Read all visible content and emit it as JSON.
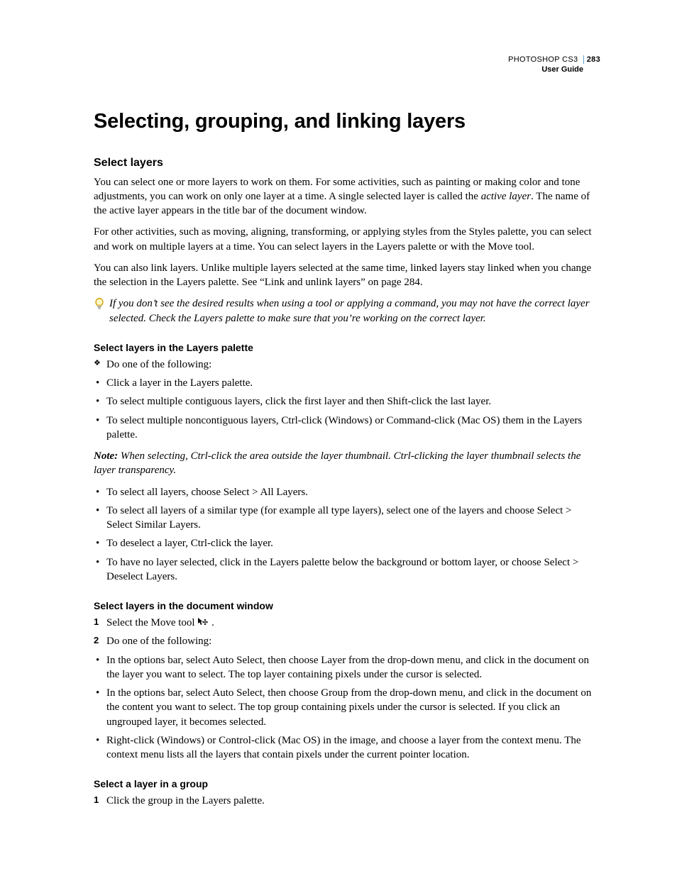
{
  "header": {
    "product": "PHOTOSHOP CS3",
    "page_number": "283",
    "doc_title": "User Guide"
  },
  "h1": "Selecting, grouping, and linking layers",
  "h2_select_layers": "Select layers",
  "para1_a": "You can select one or more layers to work on them. For some activities, such as painting or making color and tone adjustments, you can work on only one layer at a time. A single selected layer is called the ",
  "para1_term": "active layer",
  "para1_b": ". The name of the active layer appears in the title bar of the document window.",
  "para2": "For other activities, such as moving, aligning, transforming, or applying styles from the Styles palette, you can select and work on multiple layers at a time. You can select layers in the Layers palette or with the Move tool.",
  "para3": "You can also link layers. Unlike multiple layers selected at the same time, linked layers stay linked when you change the selection in the Layers palette. See “Link and unlink layers” on page 284.",
  "tip": "If you don’t see the desired results when using a tool or applying a command, you may not have the correct layer selected. Check the Layers palette to make sure that you’re working on the correct layer.",
  "h3_palette": "Select layers in the Layers palette",
  "diamond": "Do one of the following:",
  "palette_bullets_1": [
    "Click a layer in the Layers palette.",
    "To select multiple contiguous layers, click the first layer and then Shift-click the last layer.",
    "To select multiple noncontiguous layers, Ctrl-click (Windows) or Command-click (Mac OS) them in the Layers palette."
  ],
  "note_label": "Note:",
  "note_body": " When selecting, Ctrl-click the area outside the layer thumbnail. Ctrl-clicking the layer thumbnail selects the layer transparency.",
  "palette_bullets_2": [
    "To select all layers, choose Select > All Layers.",
    "To select all layers of a similar type (for example all type layers), select one of the layers and choose Select > Select Similar Layers.",
    "To deselect a layer, Ctrl-click the layer.",
    "To have no layer selected, click in the Layers palette below the background or bottom layer, or choose Select > Deselect Layers."
  ],
  "h3_docwin": "Select layers in the document window",
  "step1_prefix": "Select the Move tool ",
  "step1_suffix": " .",
  "step2": "Do one of the following:",
  "docwin_bullets": [
    "In the options bar, select Auto Select, then choose Layer from the drop-down menu, and click in the document on the layer you want to select. The top layer containing pixels under the cursor is selected.",
    "In the options bar, select Auto Select, then choose Group from the drop-down menu, and click in the document on the content you want to select. The top group containing pixels under the cursor is selected. If you click an ungrouped layer, it becomes selected.",
    "Right-click (Windows) or Control-click (Mac OS) in the image, and choose a layer from the context menu. The context menu lists all the layers that contain pixels under the current pointer location."
  ],
  "h3_group": "Select a layer in a group",
  "group_step1": "Click the group in the Layers palette."
}
